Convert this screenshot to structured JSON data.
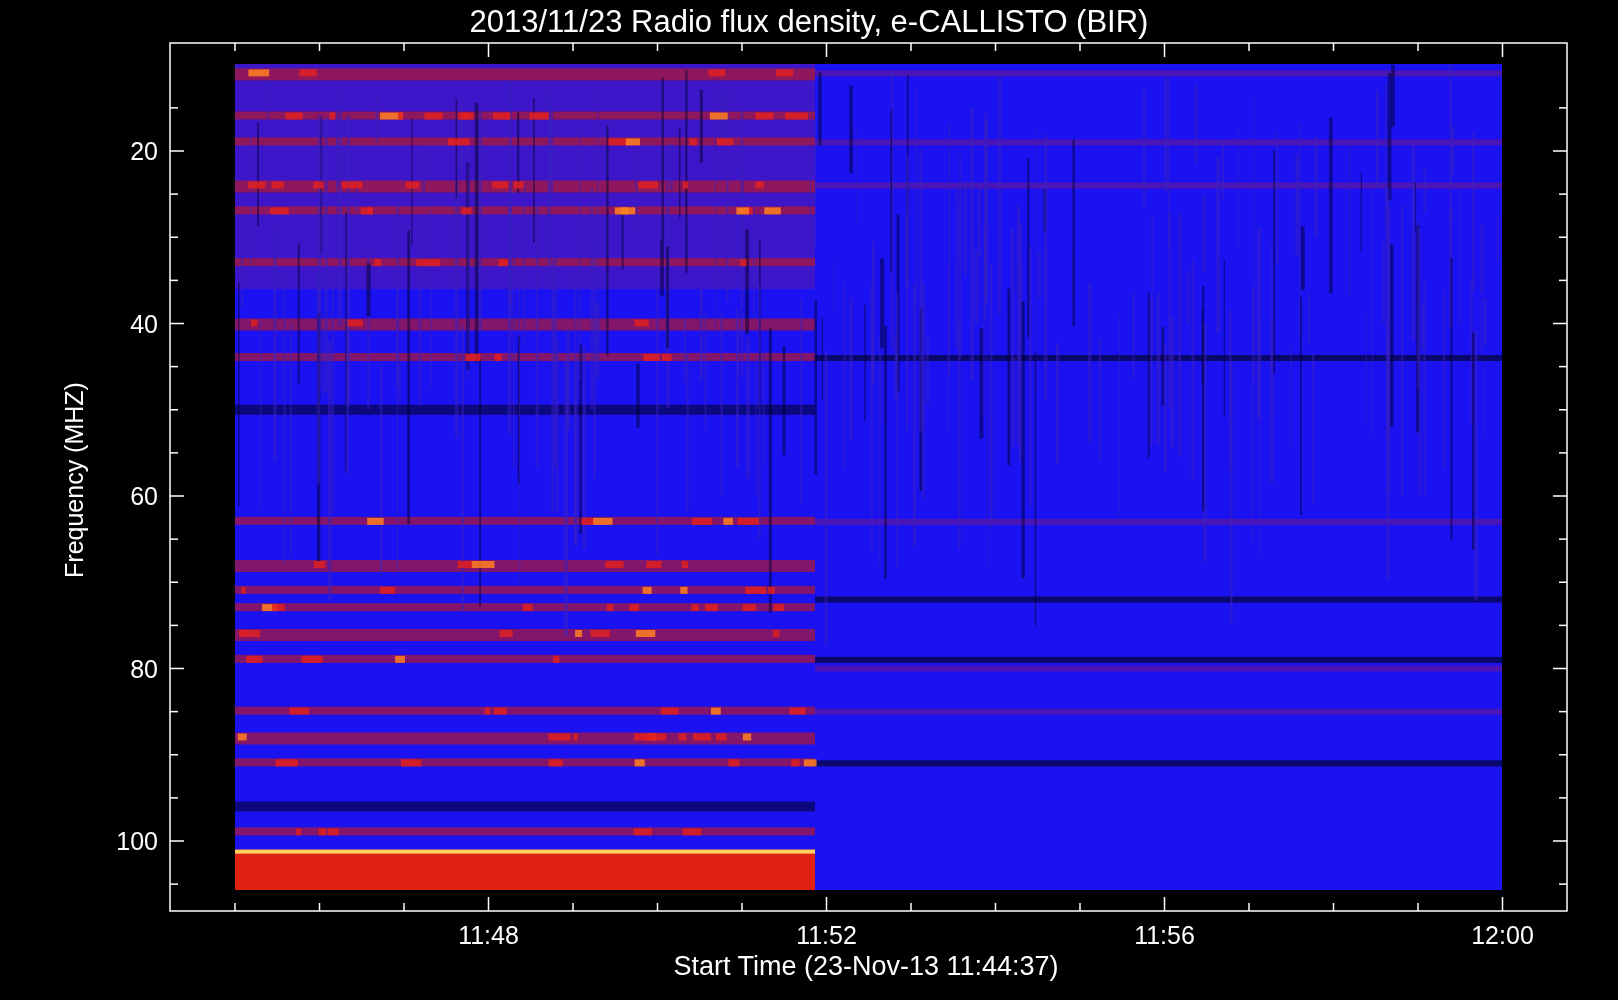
{
  "title": "2013/11/23  Radio flux density, e-CALLISTO (BIR)",
  "y_axis": {
    "label": "Frequency (MHZ)",
    "ticks": [
      "20",
      "40",
      "60",
      "80",
      "100"
    ]
  },
  "x_axis": {
    "label": "Start Time (23-Nov-13 11:44:37)",
    "ticks": [
      "11:48",
      "11:52",
      "11:56",
      "12:00"
    ]
  }
}
